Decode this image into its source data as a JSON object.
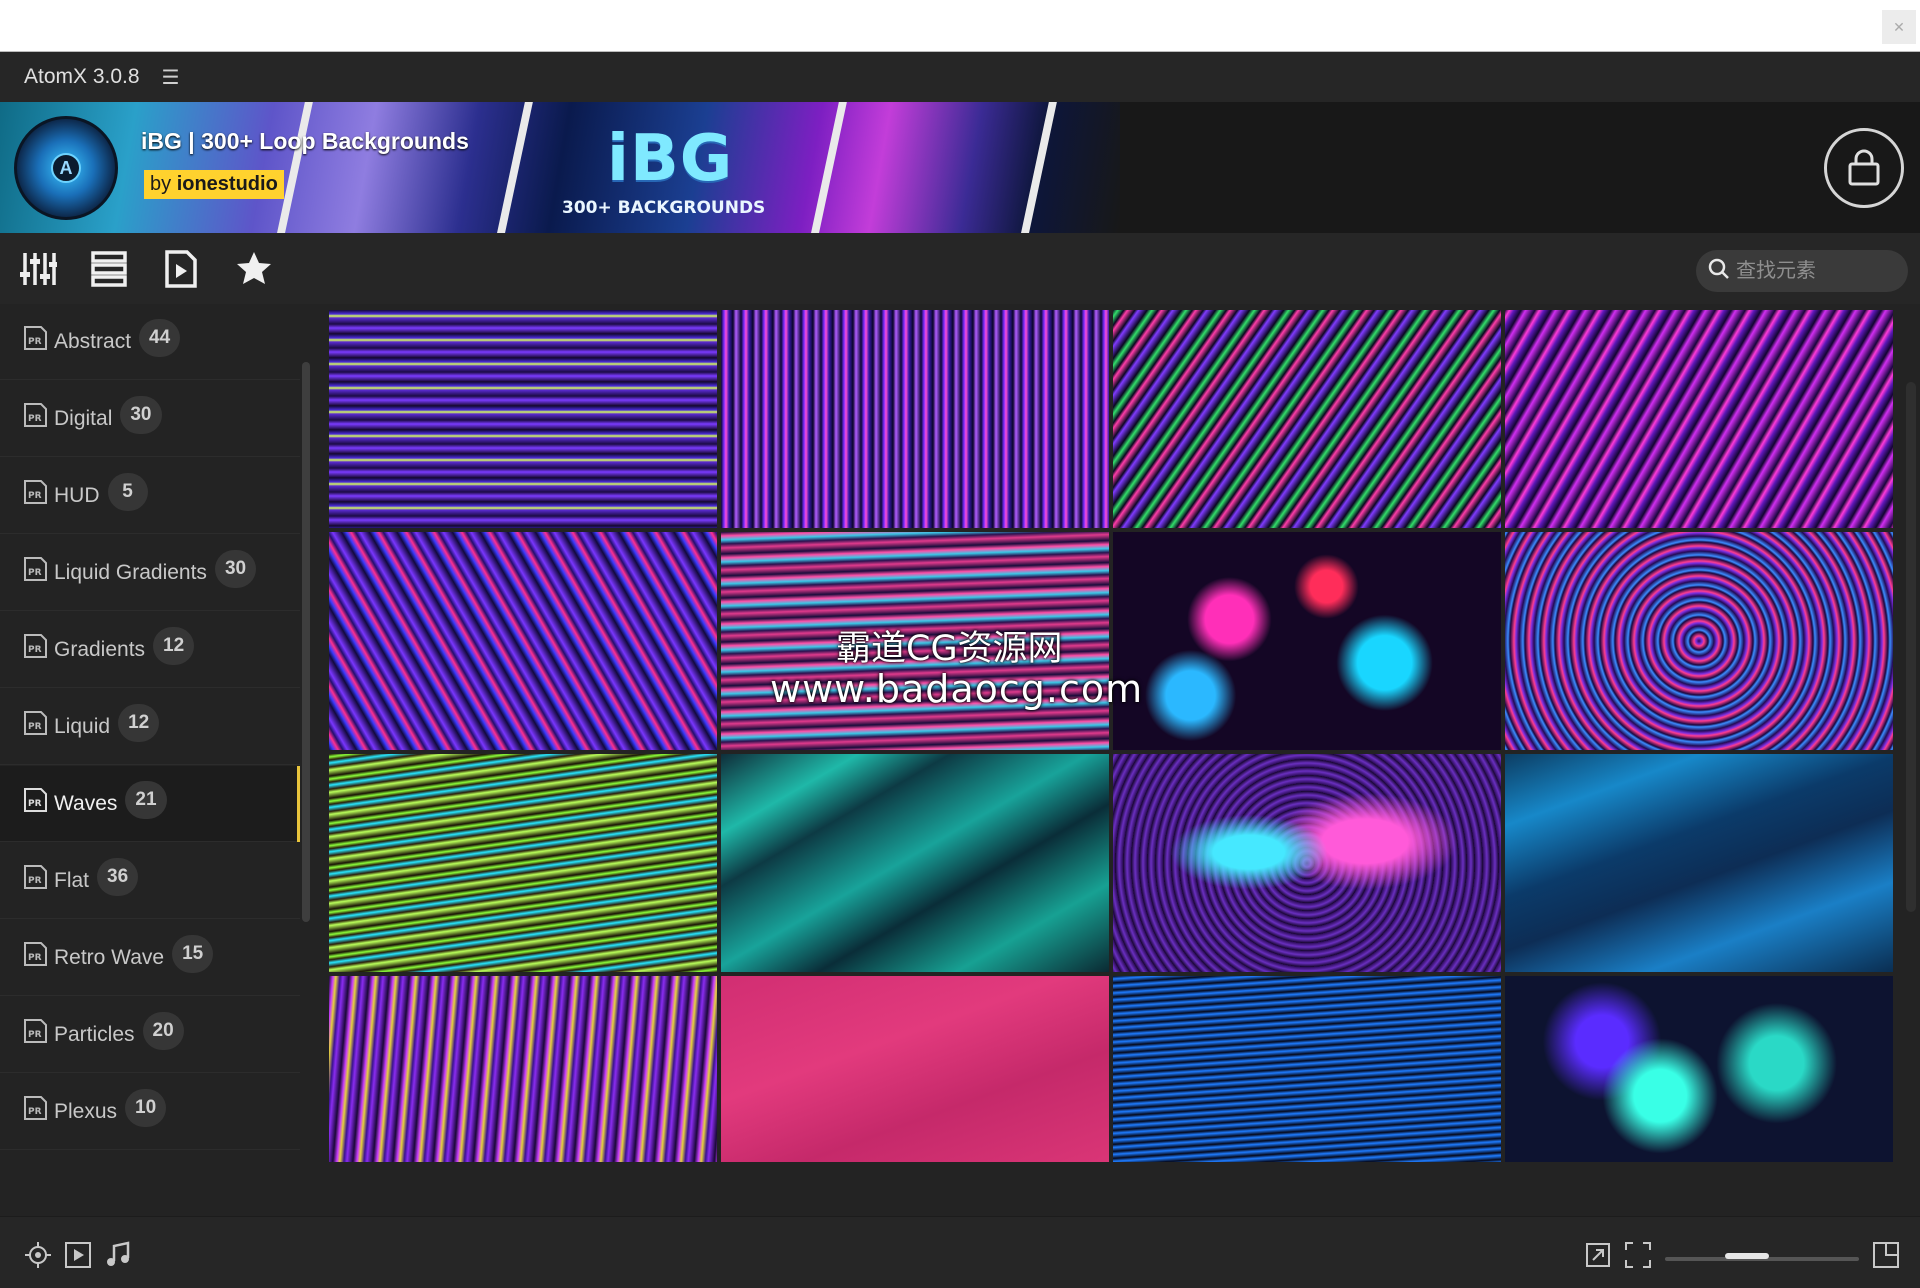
{
  "app": {
    "title": "AtomX 3.0.8",
    "menu_icon": "hamburger-icon"
  },
  "banner": {
    "title": "iBG | 300+ Loop Backgrounds",
    "by_prefix": "by",
    "by_author": "ionestudio",
    "art_title": "iBG",
    "art_subtitle": "300+ BACKGROUNDS",
    "logo_letter": "A",
    "shop_icon": "shopping-bag-icon"
  },
  "toolbar": {
    "tools": [
      "sliders-icon",
      "list-icon",
      "video-file-icon",
      "star-icon"
    ],
    "search_placeholder": "查找元素"
  },
  "sidebar": {
    "items": [
      {
        "label": "Abstract",
        "count": "44"
      },
      {
        "label": "Digital",
        "count": "30"
      },
      {
        "label": "HUD",
        "count": "5"
      },
      {
        "label": "Liquid Gradients",
        "count": "30"
      },
      {
        "label": "Gradients",
        "count": "12"
      },
      {
        "label": "Liquid",
        "count": "12"
      },
      {
        "label": "Waves",
        "count": "21",
        "active": true
      },
      {
        "label": "Flat",
        "count": "36"
      },
      {
        "label": "Retro Wave",
        "count": "15"
      },
      {
        "label": "Particles",
        "count": "20"
      },
      {
        "label": "Plexus",
        "count": "10"
      }
    ]
  },
  "watermark": {
    "line1": "霸道CG资源网",
    "line2": "www.badaocg.com"
  },
  "bottombar": {
    "left_icons": [
      "target-icon",
      "play-icon",
      "music-icon"
    ],
    "right_icons": [
      "external-link-icon",
      "fit-icon",
      "grid-size-icon"
    ]
  }
}
